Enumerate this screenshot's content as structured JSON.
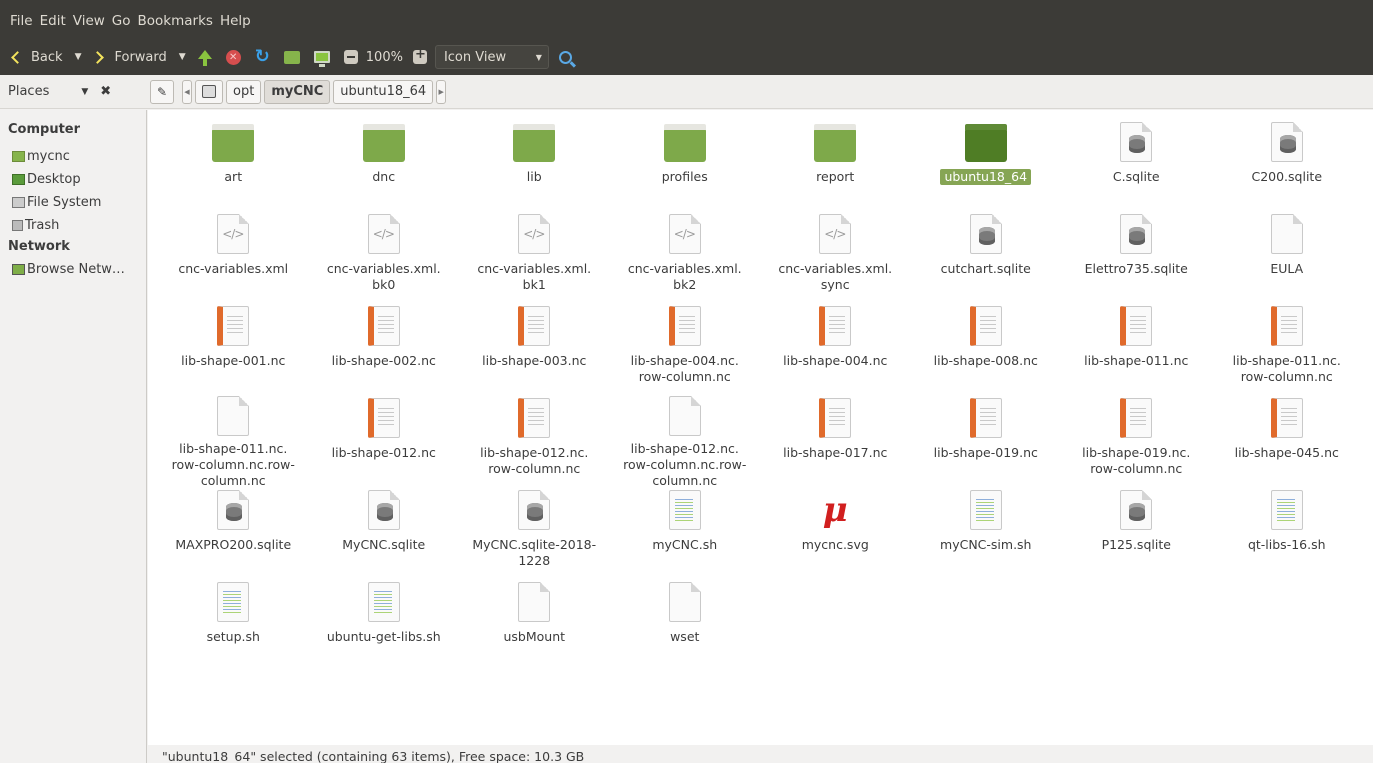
{
  "menu": [
    "File",
    "Edit",
    "View",
    "Go",
    "Bookmarks",
    "Help"
  ],
  "toolbar": {
    "back_label": "Back",
    "forward_label": "Forward",
    "zoom": "100%",
    "view_mode": "Icon View"
  },
  "location": {
    "places_label": "Places",
    "crumbs": [
      "opt",
      "myCNC",
      "ubuntu18_64"
    ],
    "active_crumb": "myCNC"
  },
  "sidebar": {
    "computer_heading": "Computer",
    "computer_items": [
      {
        "label": "mycnc",
        "icon": "home-icon"
      },
      {
        "label": "Desktop",
        "icon": "desktop-icon"
      },
      {
        "label": "File System",
        "icon": "drive-icon"
      },
      {
        "label": "Trash",
        "icon": "trash-icon"
      }
    ],
    "network_heading": "Network",
    "network_items": [
      {
        "label": "Browse Netw…",
        "icon": "network-icon"
      }
    ]
  },
  "files": [
    {
      "name": "art",
      "type": "folder"
    },
    {
      "name": "dnc",
      "type": "folder"
    },
    {
      "name": "lib",
      "type": "folder"
    },
    {
      "name": "profiles",
      "type": "folder"
    },
    {
      "name": "report",
      "type": "folder"
    },
    {
      "name": "ubuntu18_64",
      "type": "folder",
      "selected": true
    },
    {
      "name": "C.sqlite",
      "type": "database"
    },
    {
      "name": "C200.sqlite",
      "type": "database"
    },
    {
      "name": "cnc-variables.xml",
      "type": "xml"
    },
    {
      "name": "cnc-variables.xml.\nbk0",
      "type": "xml"
    },
    {
      "name": "cnc-variables.xml.\nbk1",
      "type": "xml"
    },
    {
      "name": "cnc-variables.xml.\nbk2",
      "type": "xml"
    },
    {
      "name": "cnc-variables.xml.\nsync",
      "type": "xml"
    },
    {
      "name": "cutchart.sqlite",
      "type": "database"
    },
    {
      "name": "Elettro735.sqlite",
      "type": "database"
    },
    {
      "name": "EULA",
      "type": "blank"
    },
    {
      "name": "lib-shape-001.nc",
      "type": "nc"
    },
    {
      "name": "lib-shape-002.nc",
      "type": "nc"
    },
    {
      "name": "lib-shape-003.nc",
      "type": "nc"
    },
    {
      "name": "lib-shape-004.nc.\nrow-column.nc",
      "type": "nc"
    },
    {
      "name": "lib-shape-004.nc",
      "type": "nc"
    },
    {
      "name": "lib-shape-008.nc",
      "type": "nc"
    },
    {
      "name": "lib-shape-011.nc",
      "type": "nc"
    },
    {
      "name": "lib-shape-011.nc.\nrow-column.nc",
      "type": "nc"
    },
    {
      "name": "lib-shape-011.nc.\nrow-column.nc.row-\ncolumn.nc",
      "type": "blank"
    },
    {
      "name": "lib-shape-012.nc",
      "type": "nc"
    },
    {
      "name": "lib-shape-012.nc.\nrow-column.nc",
      "type": "nc"
    },
    {
      "name": "lib-shape-012.nc.\nrow-column.nc.row-\ncolumn.nc",
      "type": "blank"
    },
    {
      "name": "lib-shape-017.nc",
      "type": "nc"
    },
    {
      "name": "lib-shape-019.nc",
      "type": "nc"
    },
    {
      "name": "lib-shape-019.nc.\nrow-column.nc",
      "type": "nc"
    },
    {
      "name": "lib-shape-045.nc",
      "type": "nc"
    },
    {
      "name": "MAXPRO200.sqlite",
      "type": "database"
    },
    {
      "name": "MyCNC.sqlite",
      "type": "database"
    },
    {
      "name": "MyCNC.sqlite-2018-\n1228",
      "type": "database"
    },
    {
      "name": "myCNC.sh",
      "type": "script"
    },
    {
      "name": "mycnc.svg",
      "type": "svg"
    },
    {
      "name": "myCNC-sim.sh",
      "type": "script"
    },
    {
      "name": "P125.sqlite",
      "type": "database"
    },
    {
      "name": "qt-libs-16.sh",
      "type": "script"
    },
    {
      "name": "setup.sh",
      "type": "script"
    },
    {
      "name": "ubuntu-get-libs.sh",
      "type": "script"
    },
    {
      "name": "usbMount",
      "type": "blank"
    },
    {
      "name": "wset",
      "type": "blank"
    }
  ],
  "status": {
    "text": "\"ubuntu18_64\" selected (containing 63 items), Free space: 10.3 GB"
  }
}
